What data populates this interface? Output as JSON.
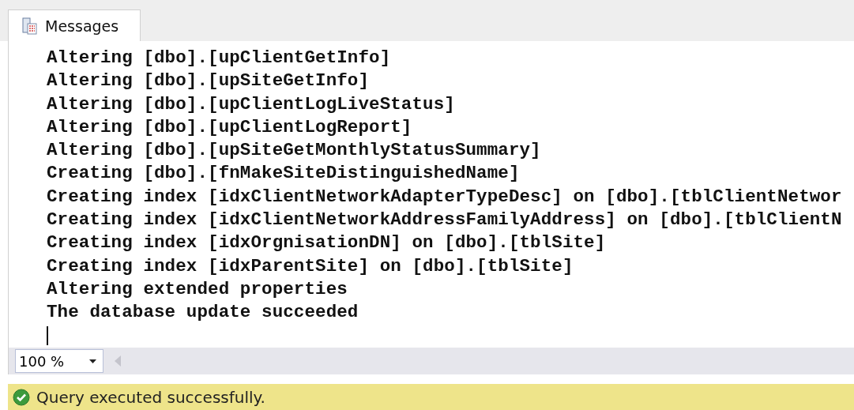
{
  "tabs": [
    {
      "label": "Messages",
      "selected": true
    }
  ],
  "messages": [
    "Altering [dbo].[upClientGetInfo]",
    "Altering [dbo].[upSiteGetInfo]",
    "Altering [dbo].[upClientLogLiveStatus]",
    "Altering [dbo].[upClientLogReport]",
    "Altering [dbo].[upSiteGetMonthlyStatusSummary]",
    "Creating [dbo].[fnMakeSiteDistinguishedName]",
    "Creating index [idxClientNetworkAdapterTypeDesc] on [dbo].[tblClientNetwor",
    "Creating index [idxClientNetworkAddressFamilyAddress] on [dbo].[tblClientN",
    "Creating index [idxOrgnisationDN] on [dbo].[tblSite]",
    "Creating index [idxParentSite] on [dbo].[tblSite]",
    "Altering extended properties",
    "The database update succeeded"
  ],
  "zoom": {
    "value": "100 %"
  },
  "status_bar": {
    "text": "Query executed successfully."
  }
}
